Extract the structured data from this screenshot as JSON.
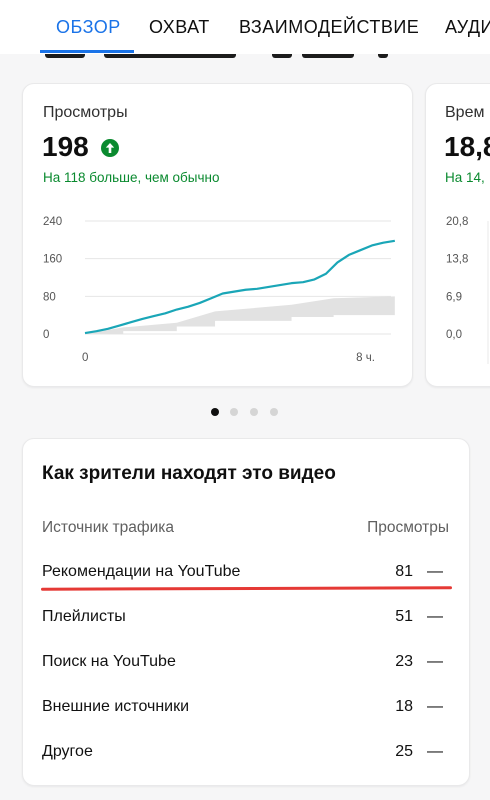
{
  "tabs": [
    {
      "label": "ОБЗОР",
      "active": true
    },
    {
      "label": "ОХВАТ",
      "active": false
    },
    {
      "label": "ВЗАИМОДЕЙСТВИЕ",
      "active": false
    },
    {
      "label": "АУДИ",
      "active": false
    }
  ],
  "colors": {
    "accent": "#1a73e8",
    "positive": "#0a8a2f",
    "line": "#1aa6b7",
    "typical_range": "#e2e2e2",
    "highlight": "#e53935"
  },
  "metric_cards": [
    {
      "label": "Просмотры",
      "value": "198",
      "icon": "arrow-up-circle-icon",
      "comparison": "На 118 больше, чем обычно"
    },
    {
      "label": "Врем",
      "value": "18,8",
      "comparison": "На 14,",
      "y_ticks": [
        "20,8",
        "13,8",
        "6,9",
        "0,0"
      ]
    }
  ],
  "chart_data": {
    "type": "line",
    "title": "",
    "xlabel": "",
    "ylabel": "",
    "x_tick_labels": [
      "0",
      "8 ч."
    ],
    "y_tick_labels": [
      "240",
      "160",
      "80",
      "0"
    ],
    "ylim": [
      0,
      240
    ],
    "xlim": [
      0,
      8
    ],
    "grid": true,
    "series": [
      {
        "x": [
          0,
          0.3,
          0.6,
          0.9,
          1.2,
          1.5,
          1.8,
          2.1,
          2.4,
          2.7,
          3.0,
          3.3,
          3.6,
          3.9,
          4.2,
          4.5,
          4.8,
          5.1,
          5.4,
          5.7,
          6.0,
          6.3,
          6.6,
          6.9,
          7.2,
          7.5,
          7.8,
          8.1
        ],
        "y": [
          2,
          6,
          11,
          18,
          25,
          32,
          38,
          44,
          52,
          58,
          66,
          76,
          86,
          90,
          94,
          96,
          100,
          104,
          108,
          110,
          116,
          128,
          152,
          168,
          178,
          188,
          194,
          198
        ]
      }
    ],
    "typical_range": {
      "x": [
        0,
        1.0,
        1.0,
        2.4,
        2.4,
        3.4,
        3.4,
        5.4,
        5.4,
        6.5,
        6.5,
        8.1
      ],
      "low": [
        0,
        0,
        6,
        6,
        16,
        16,
        28,
        28,
        36,
        36,
        40,
        40
      ],
      "high": [
        0,
        14,
        14,
        24,
        24,
        48,
        48,
        62,
        62,
        76,
        76,
        80
      ]
    }
  },
  "pagination": {
    "count": 4,
    "active": 0
  },
  "traffic": {
    "title": "Как зрители находят это видео",
    "col_source": "Источник трафика",
    "col_views": "Просмотры",
    "rows": [
      {
        "label": "Рекомендации на YouTube",
        "value": "81",
        "dash": "—",
        "highlighted": true
      },
      {
        "label": "Плейлисты",
        "value": "51",
        "dash": "—"
      },
      {
        "label": "Поиск на YouTube",
        "value": "23",
        "dash": "—"
      },
      {
        "label": "Внешние источники",
        "value": "18",
        "dash": "—"
      },
      {
        "label": "Другое",
        "value": "25",
        "dash": "—"
      }
    ]
  }
}
